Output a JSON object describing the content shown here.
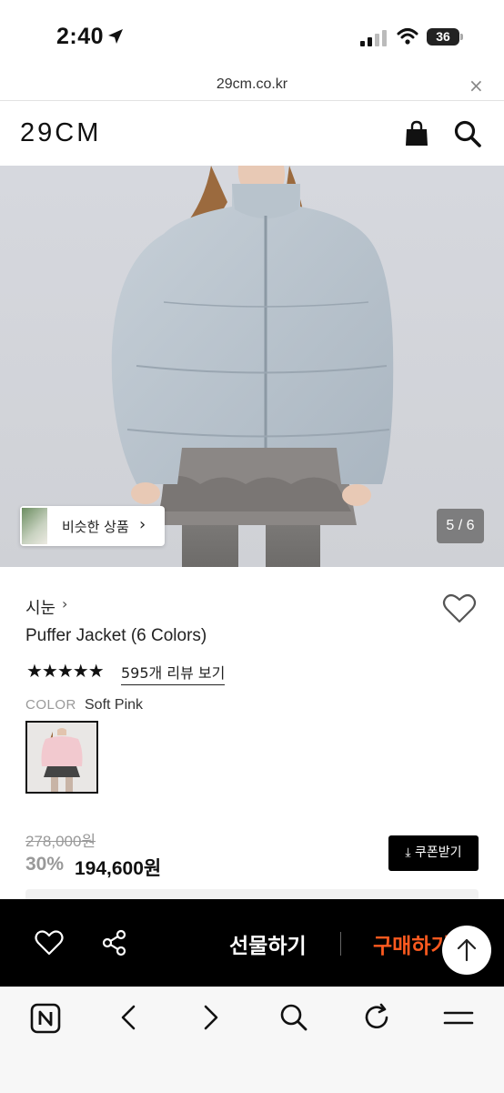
{
  "status_bar": {
    "time": "2:40",
    "battery": "36"
  },
  "browser": {
    "url": "29cm.co.kr",
    "close_glyph": "×"
  },
  "header": {
    "logo": "29CM"
  },
  "hero": {
    "similar_label": "비슷한 상품",
    "chevron": "›",
    "pager": "5 / 6"
  },
  "product": {
    "brand": "시눈",
    "brand_chevron": "›",
    "name": "Puffer Jacket (6 Colors)",
    "stars": "★★★★★",
    "review_link": "595개 리뷰 보기",
    "color_label": "COLOR",
    "color_value": "Soft Pink",
    "original_price": "278,000원",
    "discount": "30%",
    "sale_price": "194,600원",
    "coupon_label": "⤓ 쿠폰받기"
  },
  "action_bar": {
    "gift_label": "선물하기",
    "buy_label": "구매하기"
  },
  "icons": {
    "bag": "shopping-bag-icon",
    "search": "search-icon",
    "heart": "heart-icon",
    "share": "share-icon",
    "arrow_up": "arrow-up-icon"
  },
  "colors": {
    "buy_accent": "#ff5a1f",
    "action_bar_bg": "#000000"
  }
}
